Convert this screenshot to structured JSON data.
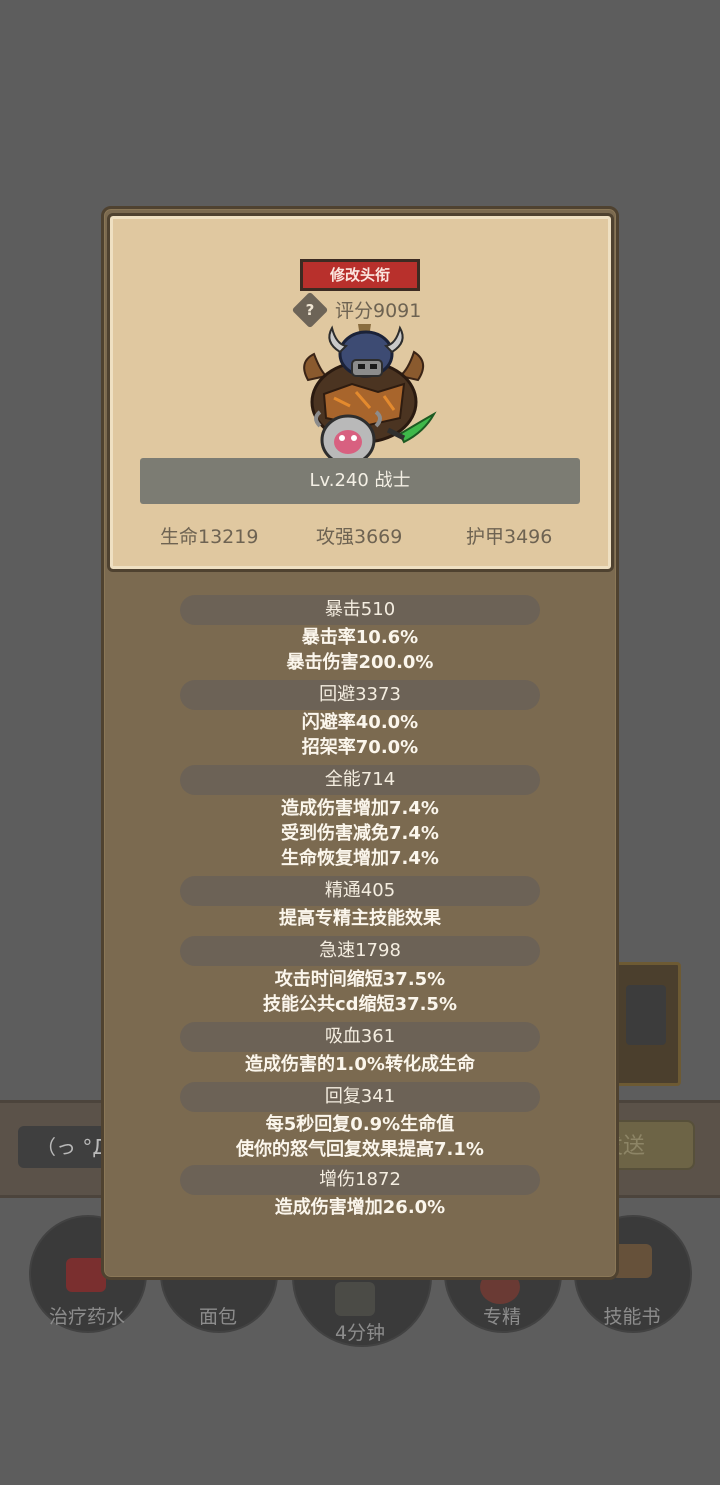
{
  "background": {
    "chat_input_text": "（っ °Д °",
    "send_button_label": "发送",
    "skills": [
      {
        "label": "治疗药水"
      },
      {
        "label": "面包"
      },
      {
        "label": "4分钟"
      },
      {
        "label": "专精"
      },
      {
        "label": "技能书"
      }
    ]
  },
  "header": {
    "rename_button": "修改头衔",
    "help_icon_glyph": "?",
    "score": "评分9091",
    "level_class": "Lv.240 战士"
  },
  "base_stats": [
    {
      "text": "生命13219"
    },
    {
      "text": "攻强3669"
    },
    {
      "text": "护甲3496"
    }
  ],
  "sections": [
    {
      "title": "暴击510",
      "lines": [
        "暴击率10.6%",
        "暴击伤害200.0%"
      ]
    },
    {
      "title": "回避3373",
      "lines": [
        "闪避率40.0%",
        "招架率70.0%"
      ]
    },
    {
      "title": "全能714",
      "lines": [
        "造成伤害增加7.4%",
        "受到伤害减免7.4%",
        "生命恢复增加7.4%"
      ]
    },
    {
      "title": "精通405",
      "lines": [
        "提高专精主技能效果"
      ]
    },
    {
      "title": "急速1798",
      "lines": [
        "攻击时间缩短37.5%",
        "技能公共cd缩短37.5%"
      ]
    },
    {
      "title": "吸血361",
      "lines": [
        "造成伤害的1.0%转化成生命"
      ]
    },
    {
      "title": "回复341",
      "lines": [
        "每5秒回复0.9%生命值",
        "使你的怒气回复效果提高7.1%"
      ]
    },
    {
      "title": "增伤1872",
      "lines": [
        "造成伤害增加26.0%"
      ]
    }
  ],
  "colors": {
    "panel": "#7b6a50",
    "card": "#e0c8a0",
    "rename_button": "#b8302c",
    "section_bar": "#6c6256"
  }
}
